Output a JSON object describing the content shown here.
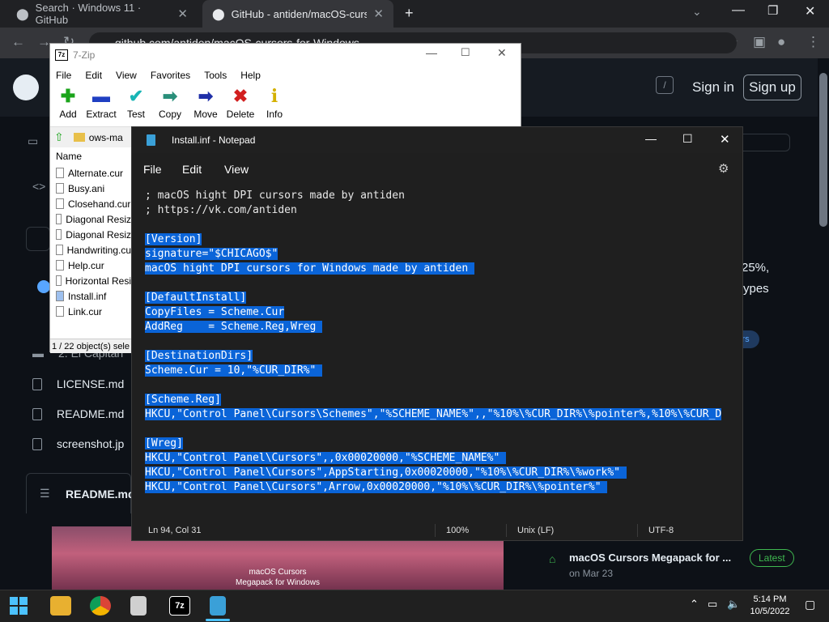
{
  "chrome": {
    "tabs": [
      {
        "title": "Search · Windows 11 · GitHub"
      },
      {
        "title": "GitHub - antiden/macOS-cursors"
      }
    ],
    "url": "github.com/antiden/macOS-cursors-for-Windows"
  },
  "github": {
    "sign_in": "Sign in",
    "sign_up": "Sign up",
    "search_key": "/",
    "files": [
      "2. El Capitan",
      "LICENSE.md",
      "README.md",
      "screenshot.jp"
    ],
    "readme_label": "README.md",
    "about_fragment_1": "25%,",
    "about_fragment_2": "ypes",
    "topic_fragment": "rs",
    "release": {
      "title": "macOS Cursors Megapack for ...",
      "badge": "Latest",
      "date": "on Mar 23"
    },
    "preview_title": "macOS Cursors",
    "preview_subtitle": "Megapack for Windows"
  },
  "zip": {
    "title": "7-Zip",
    "menu": [
      "File",
      "Edit",
      "View",
      "Favorites",
      "Tools",
      "Help"
    ],
    "toolbar": [
      {
        "label": "Add",
        "icon": "plus-icon",
        "color": "#1aa41a"
      },
      {
        "label": "Extract",
        "icon": "minus-icon",
        "color": "#1f3fc2"
      },
      {
        "label": "Test",
        "icon": "check-icon",
        "color": "#18b5b5"
      },
      {
        "label": "Copy",
        "icon": "arrow-right-icon",
        "color": "#2a8f7a"
      },
      {
        "label": "Move",
        "icon": "arrow-right-icon",
        "color": "#1f2fa8"
      },
      {
        "label": "Delete",
        "icon": "x-icon",
        "color": "#d21f1f"
      },
      {
        "label": "Info",
        "icon": "info-icon",
        "color": "#d4b000"
      }
    ],
    "address": "ows-ma",
    "column_name": "Name",
    "files": [
      "Alternate.cur",
      "Busy.ani",
      "Closehand.cur",
      "Diagonal Resiz",
      "Diagonal Resiz",
      "Handwriting.cu",
      "Help.cur",
      "Horizontal Resi",
      "Install.inf",
      "Link.cur"
    ],
    "status": "1 / 22 object(s) sele"
  },
  "notepad": {
    "title": "Install.inf - Notepad",
    "menu": [
      "File",
      "Edit",
      "View"
    ],
    "lines": [
      {
        "text": "; macOS hight DPI cursors made by antiden",
        "sel": false
      },
      {
        "text": "; https://vk.com/antiden",
        "sel": false
      },
      {
        "text": "",
        "sel": false
      },
      {
        "text": "[Version]",
        "sel": true
      },
      {
        "text": "signature=\"$CHICAGO$\"",
        "sel": true
      },
      {
        "text": "macOS hight DPI cursors for Windows made by antiden ",
        "sel": true
      },
      {
        "text": "",
        "sel": false
      },
      {
        "text": "[DefaultInstall]",
        "sel": true
      },
      {
        "text": "CopyFiles = Scheme.Cur",
        "sel": true
      },
      {
        "text": "AddReg    = Scheme.Reg,Wreg ",
        "sel": true
      },
      {
        "text": "",
        "sel": false
      },
      {
        "text": "[DestinationDirs]",
        "sel": true
      },
      {
        "text": "Scheme.Cur = 10,\"%CUR_DIR%\" ",
        "sel": true
      },
      {
        "text": "",
        "sel": false
      },
      {
        "text": "[Scheme.Reg]",
        "sel": true
      },
      {
        "text": "HKCU,\"Control Panel\\Cursors\\Schemes\",\"%SCHEME_NAME%\",,\"%10%\\%CUR_DIR%\\%pointer%,%10%\\%CUR_D",
        "sel": true
      },
      {
        "text": "",
        "sel": false
      },
      {
        "text": "[Wreg]",
        "sel": true
      },
      {
        "text": "HKCU,\"Control Panel\\Cursors\",,0x00020000,\"%SCHEME_NAME%\" ",
        "sel": true
      },
      {
        "text": "HKCU,\"Control Panel\\Cursors\",AppStarting,0x00020000,\"%10%\\%CUR_DIR%\\%work%\" ",
        "sel": true
      },
      {
        "text": "HKCU,\"Control Panel\\Cursors\",Arrow,0x00020000,\"%10%\\%CUR_DIR%\\%pointer%\" ",
        "sel": true
      }
    ],
    "status": {
      "position": "Ln 94, Col 31",
      "zoom": "100%",
      "eol": "Unix (LF)",
      "encoding": "UTF-8"
    }
  },
  "taskbar": {
    "time": "5:14 PM",
    "date": "10/5/2022"
  },
  "colors": {
    "selection": "#0a64d8",
    "notepad_bg": "#1f1f1f",
    "github_bg": "#0d1117"
  }
}
